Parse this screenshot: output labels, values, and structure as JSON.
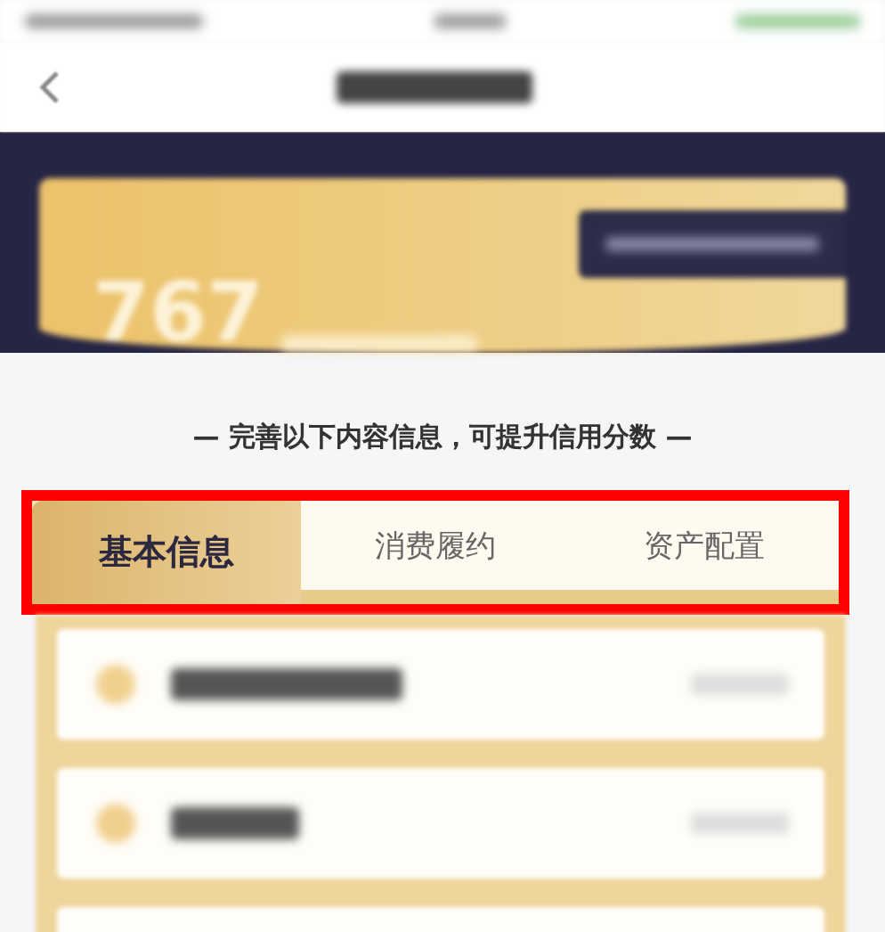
{
  "score_card": {
    "score": "767"
  },
  "hint": "— 完善以下内容信息，可提升信用分数 —",
  "tabs": [
    {
      "label": "基本信息",
      "selected": true
    },
    {
      "label": "消费履约",
      "selected": false
    },
    {
      "label": "资产配置",
      "selected": false
    }
  ],
  "list_rows": [
    {
      "kind": "blurred"
    },
    {
      "kind": "blurred"
    },
    {
      "kind": "edge"
    }
  ]
}
